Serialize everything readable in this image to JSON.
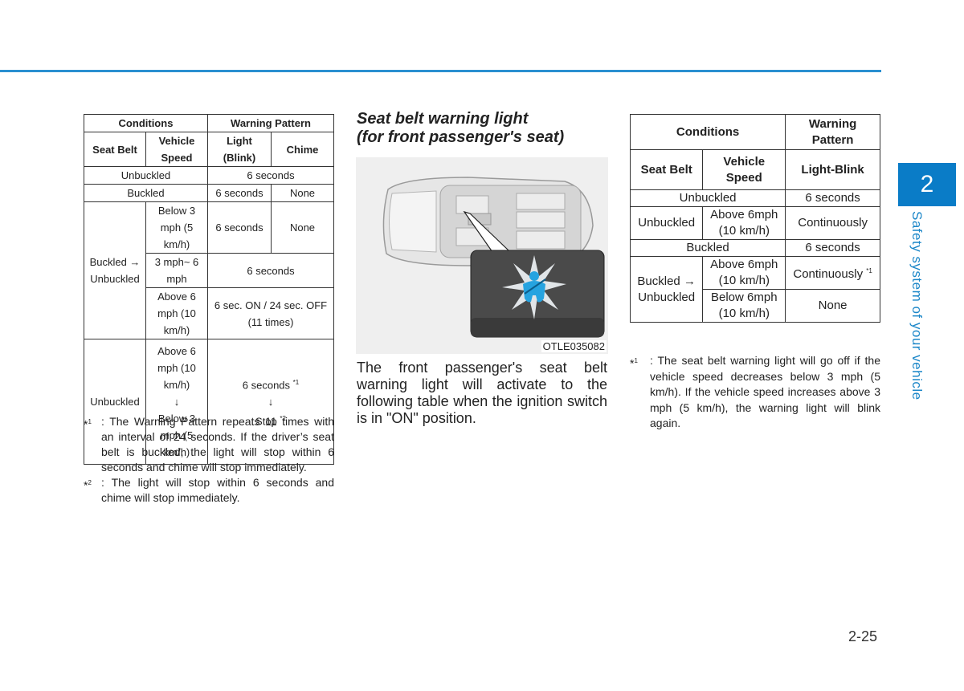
{
  "colors": {
    "accent": "#0a7cc7",
    "rule": "#2a8fd0"
  },
  "left_table": {
    "header": {
      "conditions": "Conditions",
      "warning_pattern": "Warning Pattern",
      "seat_belt": "Seat Belt",
      "vehicle_speed": "Vehicle Speed",
      "light": "Light (Blink)",
      "chime": "Chime"
    },
    "rows": {
      "r1": {
        "seat_belt": "Unbuckled",
        "pattern": "6 seconds"
      },
      "r2": {
        "seat_belt": "Buckled",
        "light": "6 seconds",
        "chime": "None"
      },
      "r3": {
        "seat_belt": "Buckled → Unbuckled",
        "a": {
          "speed": "Below 3 mph (5 km/h)",
          "light": "6 seconds",
          "chime": "None"
        },
        "b": {
          "speed": "3 mph~ 6 mph",
          "pattern": "6 seconds"
        },
        "c": {
          "speed": "Above 6 mph (10 km/h)",
          "pattern": "6 sec. ON / 24 sec. OFF (11 times)"
        }
      },
      "r4": {
        "seat_belt": "Unbuckled",
        "speed_from": "Above 6 mph (10 km/h)",
        "arrow": "↓",
        "speed_to": "Below 3 mph (5 km/h)",
        "pattern_from": "6 seconds",
        "pattern_from_note": "*1",
        "pattern_to": "Stop",
        "pattern_to_note": "*2"
      }
    },
    "footnotes": [
      {
        "mark": "*",
        "num": "1",
        "text": ": The Warning Pattern repeats 11 times with an interval of 24 seconds. If the driver’s seat belt is buckled, the light will stop within 6 seconds and chime will stop immediately."
      },
      {
        "mark": "*",
        "num": "2",
        "text": ": The light will stop within 6 seconds and chime will stop immediately."
      }
    ]
  },
  "middle": {
    "title_line1": "Seat belt warning light",
    "title_line2": "(for front passenger's seat)",
    "figure_caption": "OTLE035082",
    "body": "The front passenger's seat belt warning light will activate to the following table when the ignition switch is in \"ON\" position."
  },
  "right_table": {
    "header": {
      "conditions": "Conditions",
      "warning_pattern": "Warning Pattern",
      "seat_belt": "Seat Belt",
      "vehicle_speed": "Vehicle Speed",
      "light": "Light-Blink"
    },
    "rows": {
      "r1": {
        "seat_belt": "Unbuckled",
        "pattern": "6 seconds"
      },
      "r2": {
        "seat_belt": "Unbuckled",
        "speed": "Above 6mph (10 km/h)",
        "pattern": "Continuously"
      },
      "r3": {
        "seat_belt": "Buckled",
        "pattern": "6 seconds"
      },
      "r4": {
        "seat_belt": "Buckled → Unbuckled",
        "a": {
          "speed": "Above 6mph (10 km/h)",
          "pattern": "Continuously",
          "note": "*1"
        },
        "b": {
          "speed": "Below 6mph (10 km/h)",
          "pattern": "None"
        }
      }
    },
    "footnote": {
      "mark": "*",
      "num": "1",
      "text": ": The seat belt warning light will go off if the vehicle speed decreases below 3 mph (5 km/h). If the vehicle speed increases above 3 mph (5 km/h), the warning light will blink again."
    }
  },
  "side_tab": {
    "chapter": "2",
    "label": "Safety system of your vehicle"
  },
  "page_number": "2-25"
}
